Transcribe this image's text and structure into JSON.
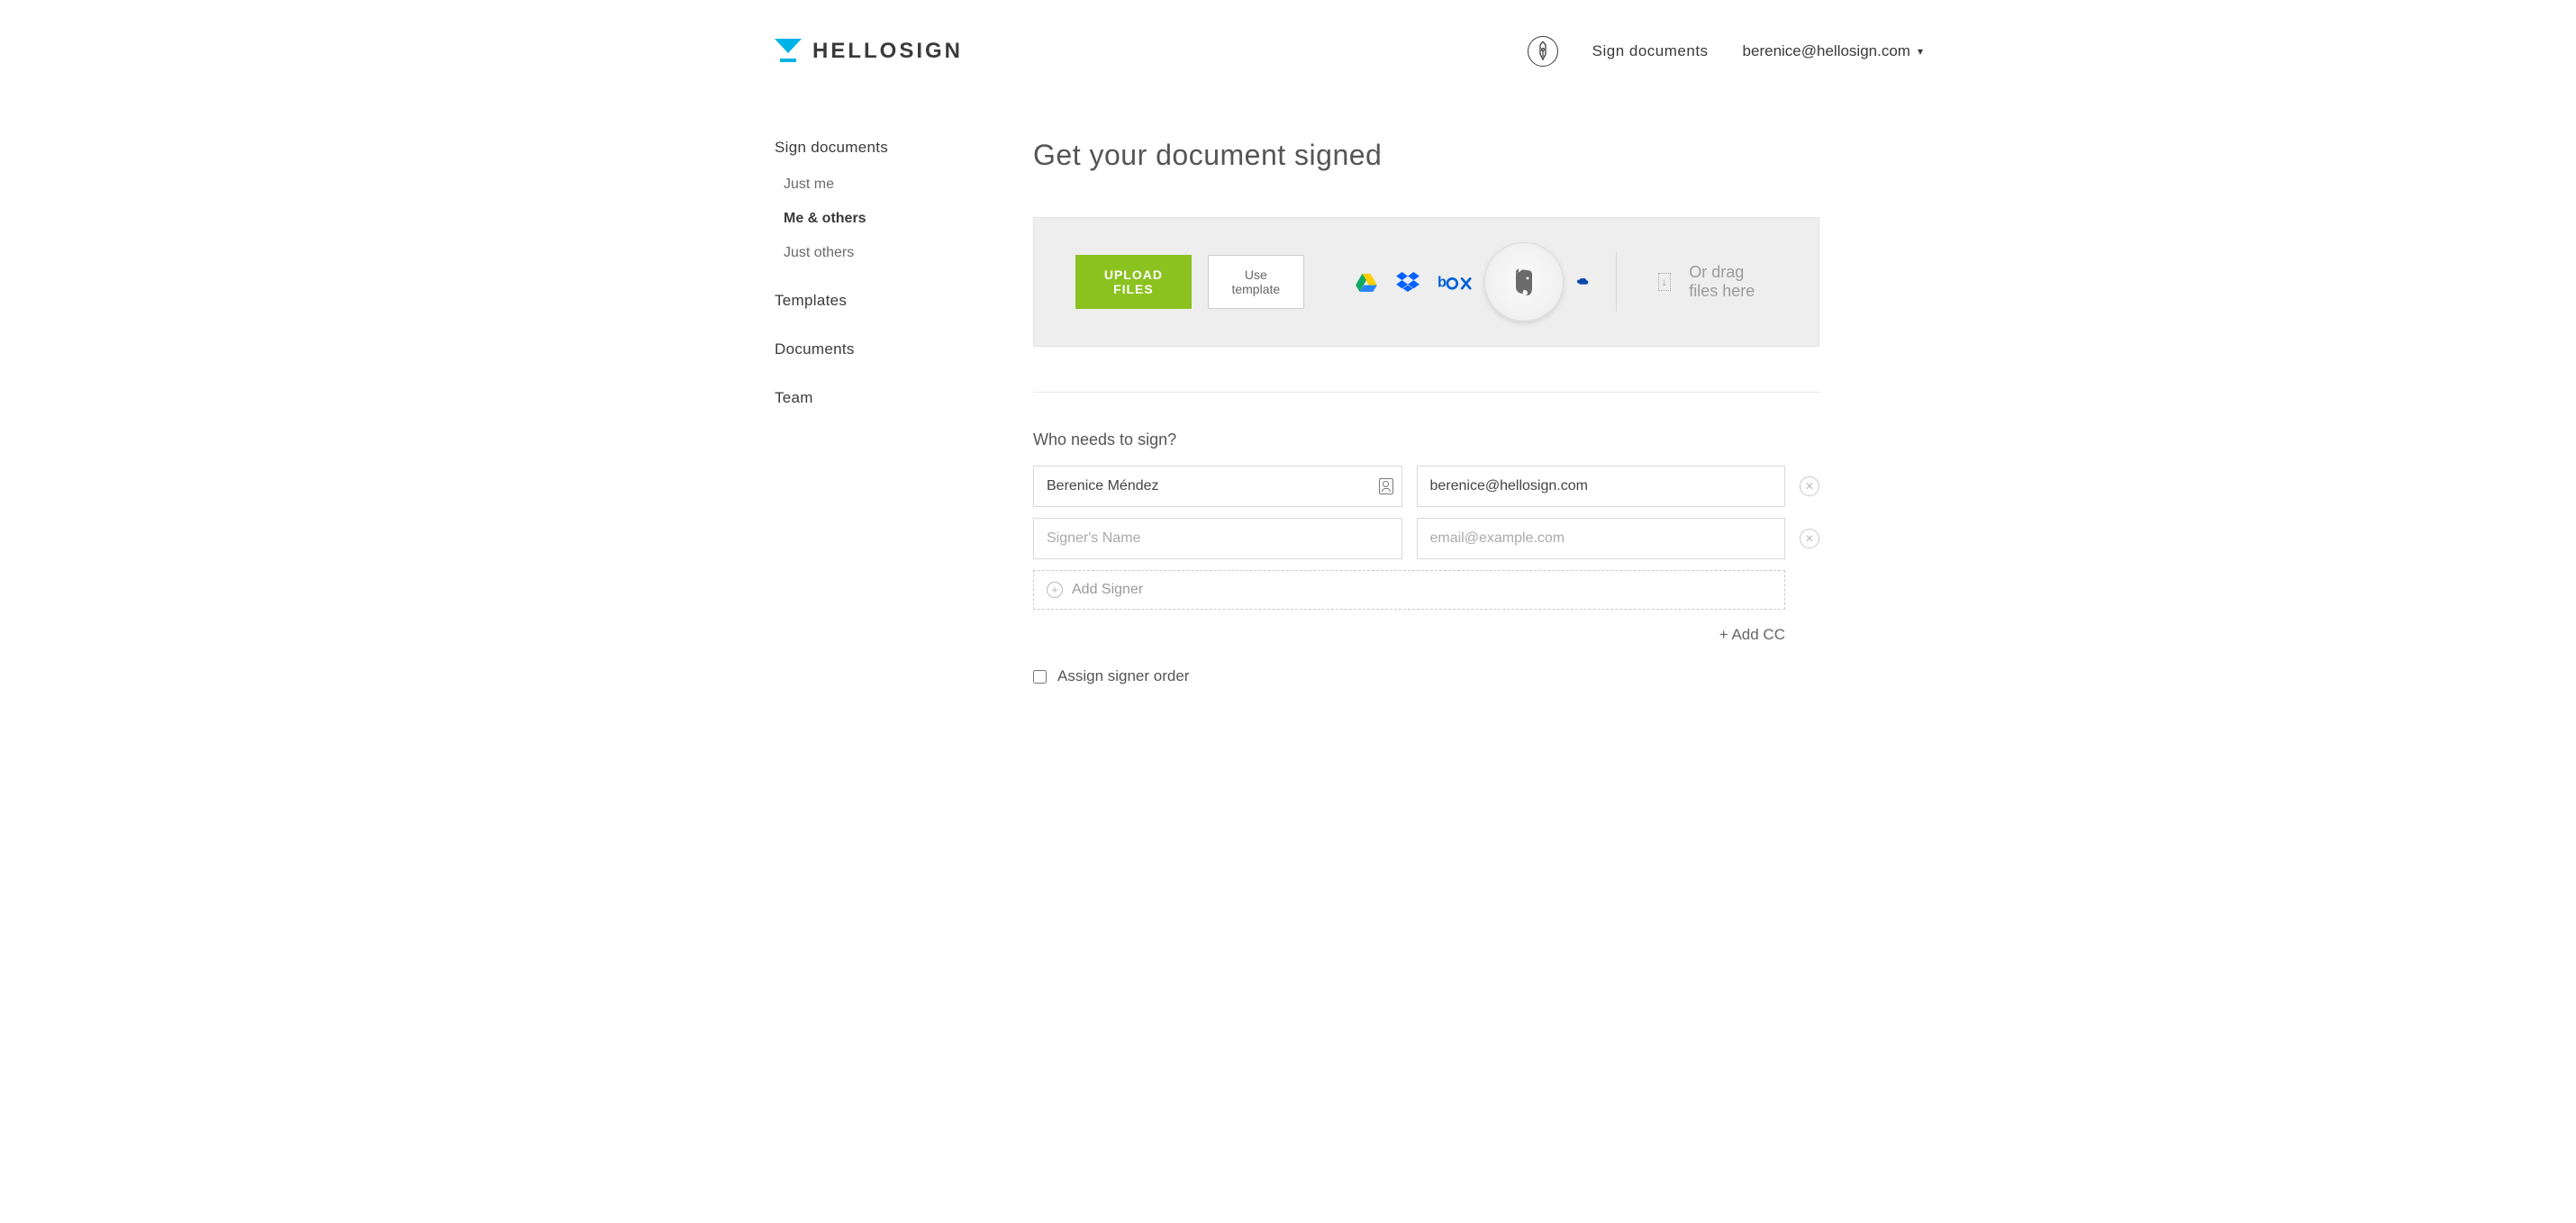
{
  "brand": {
    "name": "HELLOSIGN"
  },
  "header": {
    "sign_link": "Sign documents",
    "user_email": "berenice@hellosign.com"
  },
  "sidebar": {
    "top": "Sign documents",
    "subs": [
      {
        "label": "Just me",
        "active": false
      },
      {
        "label": "Me & others",
        "active": true
      },
      {
        "label": "Just others",
        "active": false
      }
    ],
    "links": [
      "Templates",
      "Documents",
      "Team"
    ]
  },
  "main": {
    "title": "Get your document signed",
    "upload": {
      "upload_btn": "UPLOAD FILES",
      "template_btn": "Use template",
      "drag_text": "Or drag files here",
      "integrations": [
        "google-drive",
        "dropbox",
        "box",
        "evernote",
        "onedrive"
      ]
    },
    "signers": {
      "heading": "Who needs to sign?",
      "rows": [
        {
          "name": "Berenice Méndez",
          "email": "berenice@hellosign.com",
          "name_placeholder": "",
          "email_placeholder": ""
        },
        {
          "name": "",
          "email": "",
          "name_placeholder": "Signer's Name",
          "email_placeholder": "email@example.com"
        }
      ],
      "add_signer": "Add Signer",
      "add_cc": "+ Add CC",
      "assign_order": "Assign signer order"
    }
  },
  "colors": {
    "accent": "#00b3e6",
    "upload_green": "#8bc220"
  }
}
